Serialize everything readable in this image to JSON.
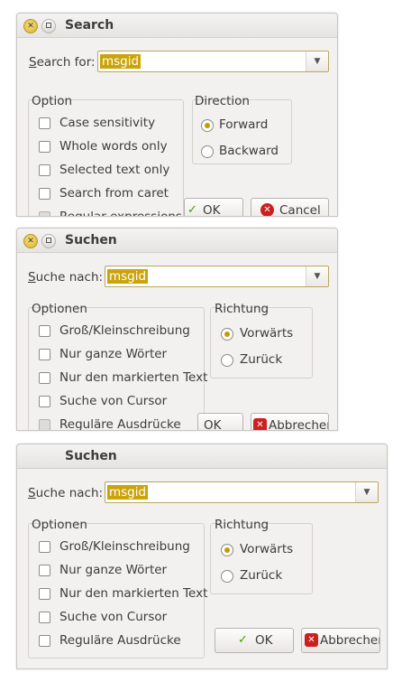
{
  "dialogs": [
    {
      "title": "Search",
      "search_label_prefix": "S",
      "search_label_rest": "earch for:",
      "search_value": "msgid",
      "options_label": "Option",
      "options": [
        "Case sensitivity",
        "Whole words only",
        "Selected text only",
        "Search from caret",
        "Regular expressions"
      ],
      "direction_label": "Direction",
      "directions": [
        "Forward",
        "Backward"
      ],
      "ok_label": "OK",
      "cancel_label": "Cancel"
    },
    {
      "title": "Suchen",
      "search_label_prefix": "S",
      "search_label_rest": "uche nach:",
      "search_value": "msgid",
      "options_label": "Optionen",
      "options": [
        "Groß/Kleinschreibung",
        "Nur ganze Wörter",
        "Nur den markierten Text",
        "Suche von Cursor",
        "Reguläre Ausdrücke"
      ],
      "direction_label": "Richtung",
      "directions": [
        "Vorwärts",
        "Zurück"
      ],
      "ok_label": "OK",
      "cancel_label": "Abbrechen"
    },
    {
      "title": "Suchen",
      "search_label_prefix": "S",
      "search_label_rest": "uche nach:",
      "search_value": "msgid",
      "options_label": "Optionen",
      "options": [
        "Groß/Kleinschreibung",
        "Nur ganze Wörter",
        "Nur den markierten Text",
        "Suche von Cursor",
        "Reguläre Ausdrücke"
      ],
      "direction_label": "Richtung",
      "directions": [
        "Vorwärts",
        "Zurück"
      ],
      "ok_label": "OK",
      "cancel_label": "Abbrechen"
    }
  ],
  "icons": {
    "close": "close-icon",
    "maximize": "maximize-icon",
    "dropdown": "chevron-down-icon",
    "ok": "checkmark-icon",
    "cancel": "cancel-icon"
  },
  "colors": {
    "selection": "#cba40a",
    "radio_selected": "#c49a06",
    "close_button": "#d7b12e",
    "cancel_icon": "#cc1f1f",
    "ok_icon": "#4e9a06"
  }
}
